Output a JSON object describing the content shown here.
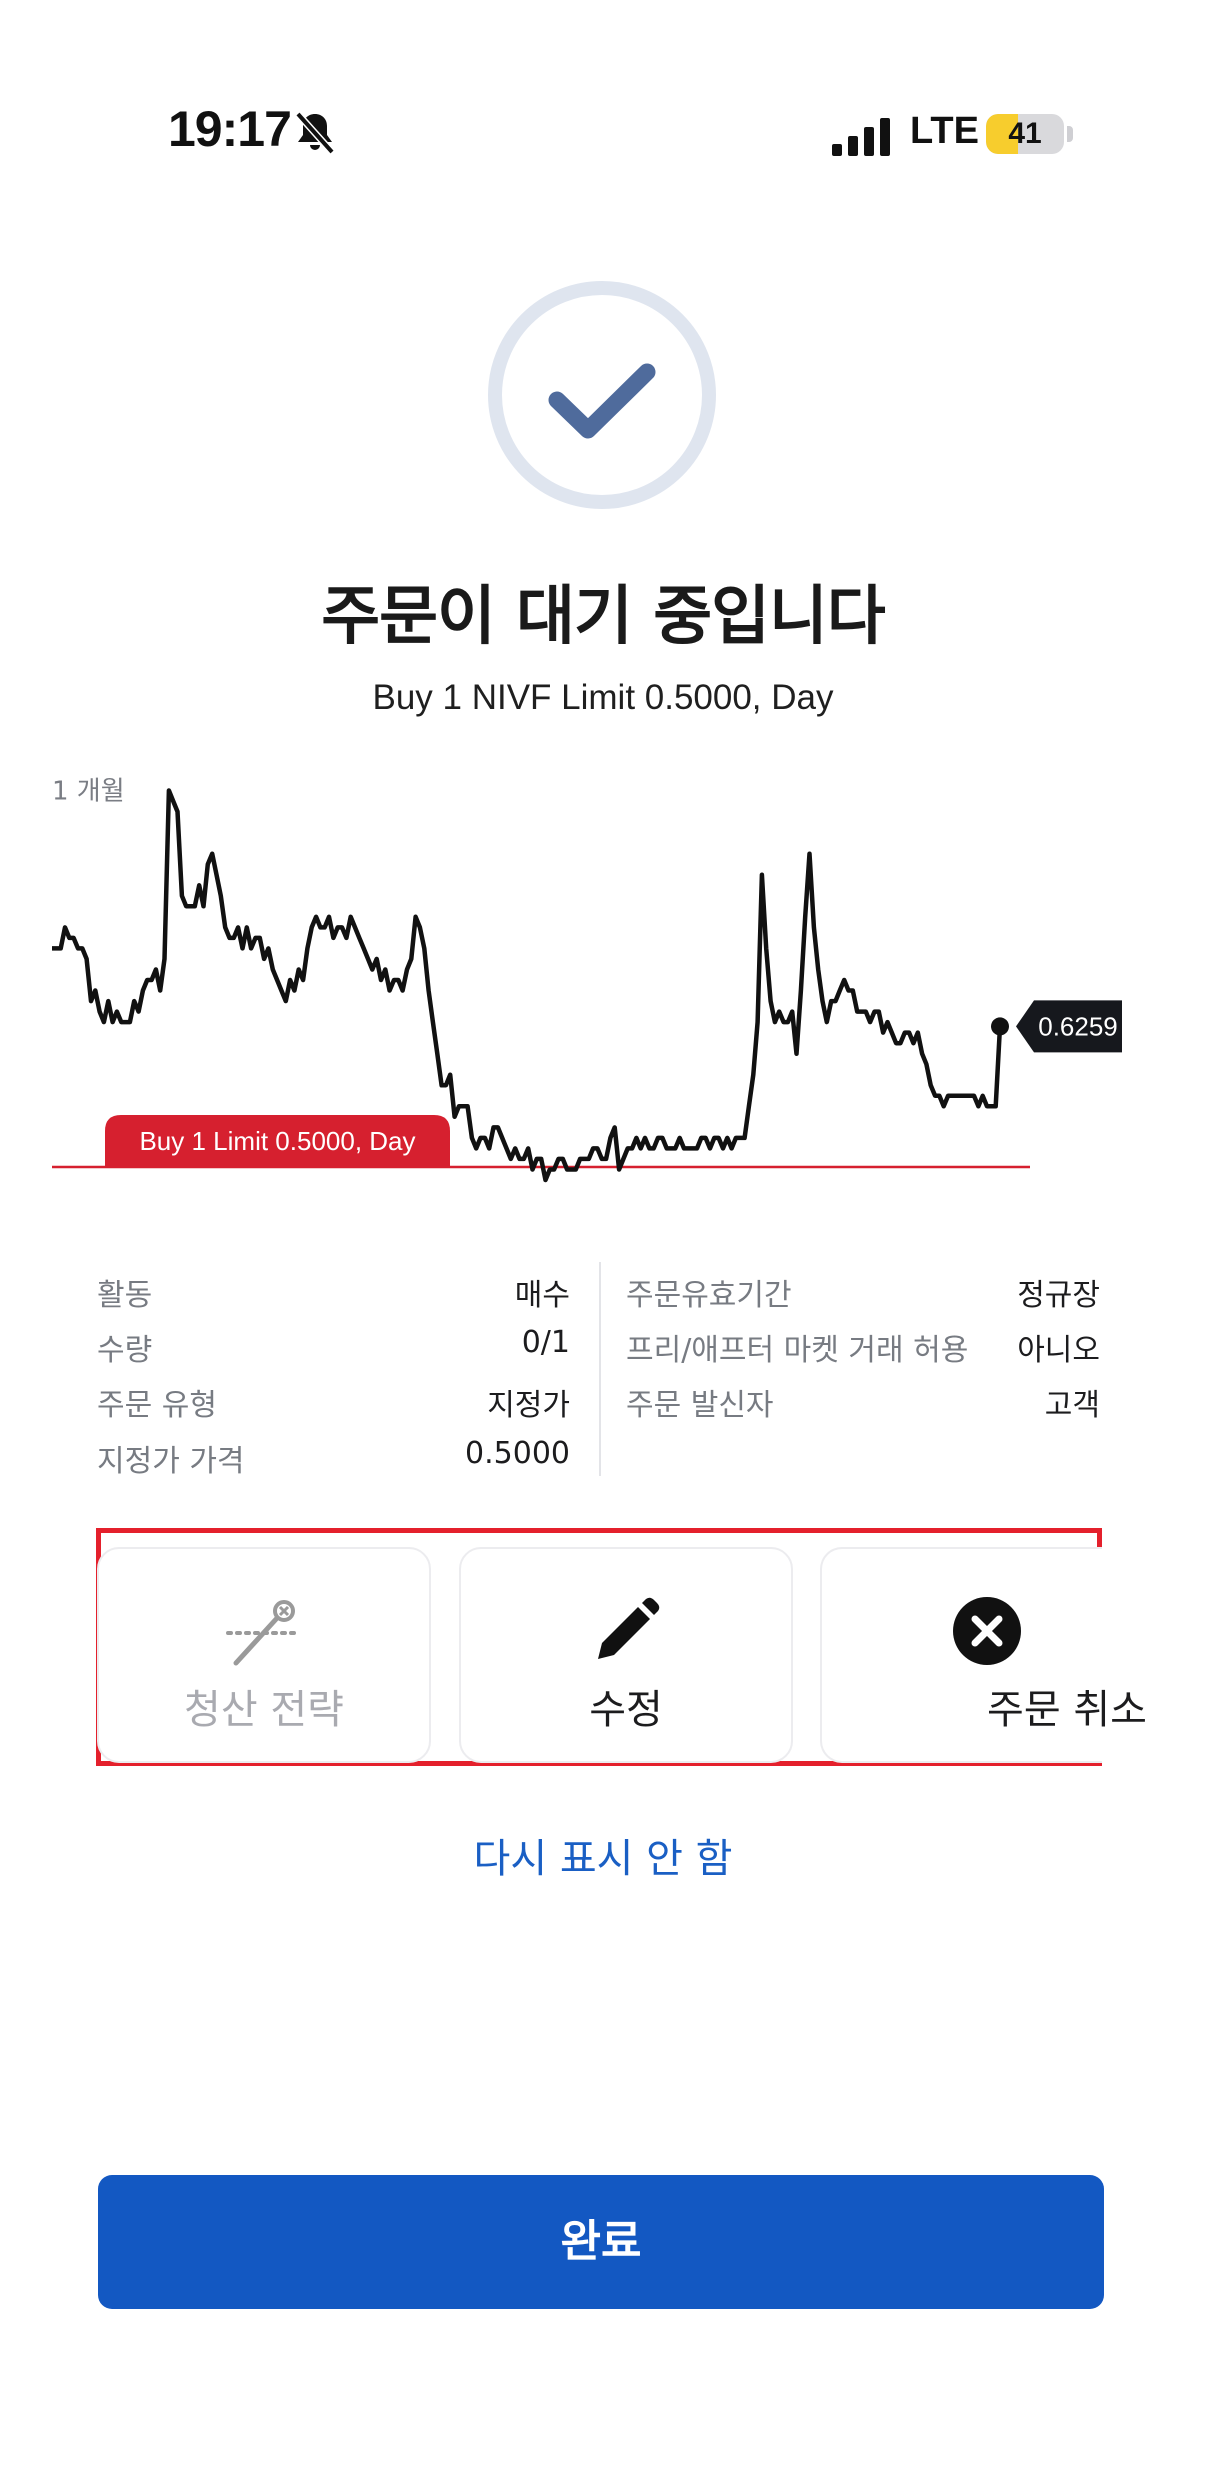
{
  "status_bar": {
    "time": "19:17",
    "network": "LTE",
    "battery": "41",
    "battery_level": 0.41
  },
  "title": "주문이 대기 중입니다",
  "subtitle": "Buy 1 NIVF Limit 0.5000, Day",
  "chart": {
    "period_label": "1 개월",
    "order_tag": "Buy 1 Limit 0.5000, Day",
    "last_price_label": "0.6259",
    "colors": {
      "line": "#111111",
      "order": "#d6202f",
      "tag_bg": "#16181d"
    }
  },
  "chart_data": {
    "type": "line",
    "series": [
      {
        "values": [
          0.7,
          0.7,
          0.7,
          0.72,
          0.71,
          0.71,
          0.7,
          0.7,
          0.69,
          0.65,
          0.66,
          0.64,
          0.63,
          0.65,
          0.63,
          0.64,
          0.63,
          0.63,
          0.63,
          0.65,
          0.64,
          0.66,
          0.67,
          0.67,
          0.68,
          0.66,
          0.69,
          0.85,
          0.84,
          0.83,
          0.75,
          0.74,
          0.74,
          0.74,
          0.76,
          0.74,
          0.78,
          0.79,
          0.77,
          0.75,
          0.72,
          0.71,
          0.71,
          0.72,
          0.7,
          0.72,
          0.7,
          0.71,
          0.71,
          0.69,
          0.7,
          0.68,
          0.67,
          0.66,
          0.65,
          0.67,
          0.66,
          0.68,
          0.67,
          0.7,
          0.72,
          0.73,
          0.72,
          0.72,
          0.73,
          0.71,
          0.72,
          0.72,
          0.71,
          0.73,
          0.72,
          0.71,
          0.7,
          0.69,
          0.68,
          0.69,
          0.67,
          0.68,
          0.66,
          0.67,
          0.67,
          0.66,
          0.68,
          0.69,
          0.73,
          0.72,
          0.7,
          0.66,
          0.63,
          0.6,
          0.57,
          0.57,
          0.58,
          0.54,
          0.55,
          0.55,
          0.55,
          0.52,
          0.51,
          0.52,
          0.52,
          0.51,
          0.53,
          0.53,
          0.52,
          0.51,
          0.5,
          0.51,
          0.5,
          0.5,
          0.51,
          0.49,
          0.5,
          0.5,
          0.48,
          0.49,
          0.49,
          0.5,
          0.5,
          0.49,
          0.49,
          0.49,
          0.5,
          0.5,
          0.5,
          0.51,
          0.51,
          0.5,
          0.5,
          0.52,
          0.53,
          0.49,
          0.5,
          0.51,
          0.51,
          0.52,
          0.51,
          0.52,
          0.51,
          0.51,
          0.52,
          0.52,
          0.51,
          0.51,
          0.51,
          0.52,
          0.51,
          0.51,
          0.51,
          0.51,
          0.52,
          0.52,
          0.51,
          0.52,
          0.52,
          0.51,
          0.52,
          0.51,
          0.52,
          0.52,
          0.52,
          0.55,
          0.58,
          0.63,
          0.77,
          0.7,
          0.65,
          0.63,
          0.64,
          0.63,
          0.63,
          0.64,
          0.6,
          0.66,
          0.73,
          0.79,
          0.72,
          0.68,
          0.65,
          0.63,
          0.65,
          0.65,
          0.66,
          0.67,
          0.66,
          0.66,
          0.64,
          0.64,
          0.64,
          0.63,
          0.64,
          0.64,
          0.62,
          0.63,
          0.62,
          0.61,
          0.61,
          0.62,
          0.62,
          0.61,
          0.62,
          0.6,
          0.59,
          0.57,
          0.56,
          0.56,
          0.55,
          0.56,
          0.56,
          0.56,
          0.56,
          0.56,
          0.56,
          0.56,
          0.55,
          0.56,
          0.55,
          0.55,
          0.55,
          0.6259
        ]
      }
    ],
    "order_level": 0.5,
    "last_price": 0.6259,
    "order_side": "Buy",
    "order_type": "Limit",
    "order_qty": 1,
    "order_tif": "Day",
    "xlabel": "",
    "ylabel": ""
  },
  "details": {
    "left": [
      {
        "label": "활동",
        "value": "매수"
      },
      {
        "label": "수량",
        "value": "0/1"
      },
      {
        "label": "주문 유형",
        "value": "지정가"
      },
      {
        "label": "지정가 가격",
        "value": "0.5000"
      }
    ],
    "right": [
      {
        "label": "주문유효기간",
        "value": "정규장"
      },
      {
        "label": "프리/애프터 마켓 거래 허용",
        "value": "아니오"
      },
      {
        "label": "주문 발신자",
        "value": "고객"
      }
    ]
  },
  "actions": [
    {
      "label": "청산 전략",
      "icon": "exit-strategy-icon",
      "enabled": false
    },
    {
      "label": "수정",
      "icon": "pencil-icon",
      "enabled": true
    },
    {
      "label": "주문 취소",
      "icon": "close-circle-icon",
      "enabled": true
    }
  ],
  "dont_show_again": "다시 표시 안 함",
  "done_button": "완료"
}
